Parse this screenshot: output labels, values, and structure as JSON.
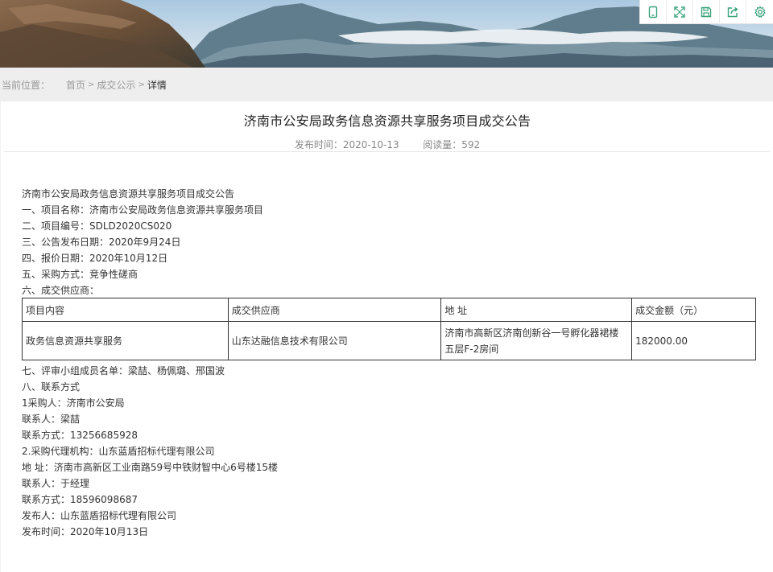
{
  "toolbar": {
    "icons": [
      "tablet-icon",
      "fullscreen-icon",
      "save-icon",
      "share-icon",
      "settings-icon"
    ]
  },
  "breadcrumb": {
    "prefix": "当前位置：",
    "home": "首页",
    "section": "成交公示",
    "current": "详情"
  },
  "article": {
    "title": "济南市公安局政务信息资源共享服务项目成交公告",
    "publish_time_label": "发布时间：",
    "publish_time": "2020-10-13",
    "read_count_label": "阅读量：",
    "read_count": "592"
  },
  "body": {
    "heading": "济南市公安局政务信息资源共享服务项目成交公告",
    "project_name": "一、项目名称：济南市公安局政务信息资源共享服务项目",
    "project_no": "二、项目编号：SDLD2020CS020",
    "announce_date": "三、公告发布日期：2020年9月24日",
    "quote_date": "四、报价日期：2020年10月12日",
    "method": "五、采购方式：竞争性磋商",
    "supplier_heading": "六、成交供应商：",
    "committee": "七、评审小组成员名单：梁喆、杨佩璐、邢国波",
    "contact_heading": "八、联系方式",
    "buyer": "1采购人：济南市公安局",
    "buyer_contact": "联系人：梁喆",
    "buyer_phone": "联系方式：13256685928",
    "agency": "2.采购代理机构：山东蓝盾招标代理有限公司",
    "agency_address": "地 址：济南市高新区工业南路59号中铁财智中心6号楼15楼",
    "agency_contact": "联系人：于经理",
    "agency_phone": "联系方式：18596098687",
    "publisher": "发布人：山东蓝盾招标代理有限公司",
    "publish_date": "发布时间：2020年10月13日"
  },
  "table": {
    "headers": [
      "项目内容",
      "成交供应商",
      "地 址",
      "成交金额（元）"
    ],
    "row": {
      "content": "政务信息资源共享服务",
      "supplier": "山东达融信息技术有限公司",
      "address": "济南市高新区济南创新谷一号孵化器裙楼五层F-2房间",
      "amount": "182000.00"
    }
  },
  "colors": {
    "toolbar_icon": "#3aa37a",
    "breadcrumb_bg": "#eeeeee"
  }
}
